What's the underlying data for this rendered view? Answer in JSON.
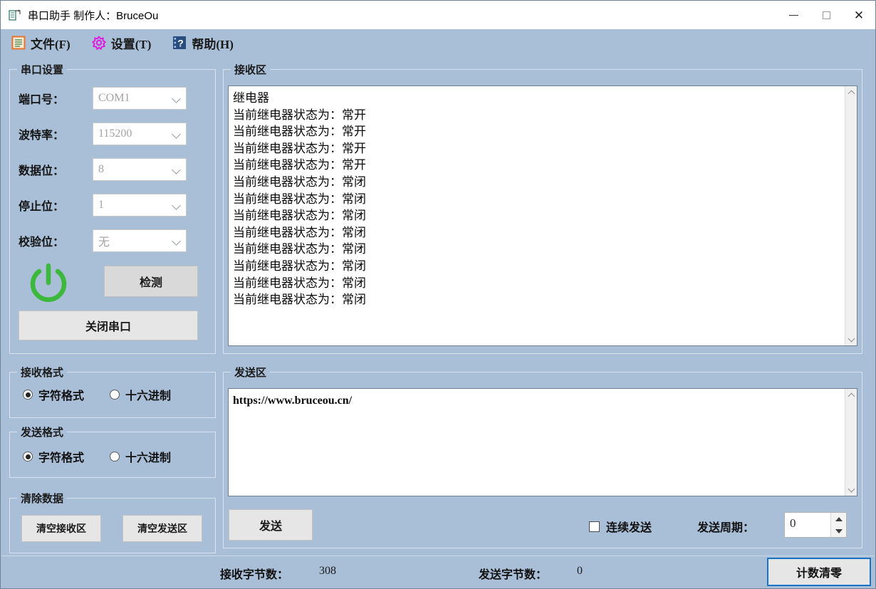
{
  "window": {
    "title": "串口助手 制作人：BruceOu",
    "icon": "serial-port-icon",
    "minimize": "—",
    "maximize": "□",
    "close": "✕"
  },
  "menu": [
    {
      "label": "文件(F)",
      "icon": "file-icon",
      "color": "#e8762a"
    },
    {
      "label": "设置(T)",
      "icon": "gear-icon",
      "color": "#e01ce0"
    },
    {
      "label": "帮助(H)",
      "icon": "help-icon",
      "color": "#2a4d7f"
    }
  ],
  "serial_settings": {
    "title": "串口设置",
    "fields": [
      {
        "label": "端口号：",
        "value": "COM1"
      },
      {
        "label": "波特率：",
        "value": "115200"
      },
      {
        "label": "数据位：",
        "value": "8"
      },
      {
        "label": "停止位：",
        "value": "1"
      },
      {
        "label": "校验位：",
        "value": "无"
      }
    ],
    "power_icon": "power-icon",
    "power_color": "#3cb83c",
    "detect_button": "检测",
    "close_port_button": "关闭串口"
  },
  "receive_format": {
    "title": "接收格式",
    "options": [
      {
        "label": "字符格式",
        "selected": true
      },
      {
        "label": "十六进制",
        "selected": false
      }
    ]
  },
  "send_format": {
    "title": "发送格式",
    "options": [
      {
        "label": "字符格式",
        "selected": true
      },
      {
        "label": "十六进制",
        "selected": false
      }
    ]
  },
  "clear_data": {
    "title": "清除数据",
    "clear_receive_button": "清空接收区",
    "clear_send_button": "清空发送区"
  },
  "receive_area": {
    "title": "接收区",
    "lines": [
      "继电器",
      "当前继电器状态为：常开",
      "当前继电器状态为：常开",
      "当前继电器状态为：常开",
      "当前继电器状态为：常开",
      "当前继电器状态为：常闭",
      "当前继电器状态为：常闭",
      "当前继电器状态为：常闭",
      "当前继电器状态为：常闭",
      "当前继电器状态为：常闭",
      "当前继电器状态为：常闭",
      "当前继电器状态为：常闭",
      "当前继电器状态为：常闭"
    ]
  },
  "send_area": {
    "title": "发送区",
    "text": "https://www.bruceou.cn/"
  },
  "send_bar": {
    "send_button": "发送",
    "continuous_send_label": "连续发送",
    "continuous_send_checked": false,
    "period_label": "发送周期：",
    "period_value": "0"
  },
  "status_bar": {
    "receive_bytes_label": "接收字节数：",
    "receive_bytes_value": "308",
    "send_bytes_label": "发送字节数：",
    "send_bytes_value": "0",
    "reset_count_button": "计数清零"
  }
}
